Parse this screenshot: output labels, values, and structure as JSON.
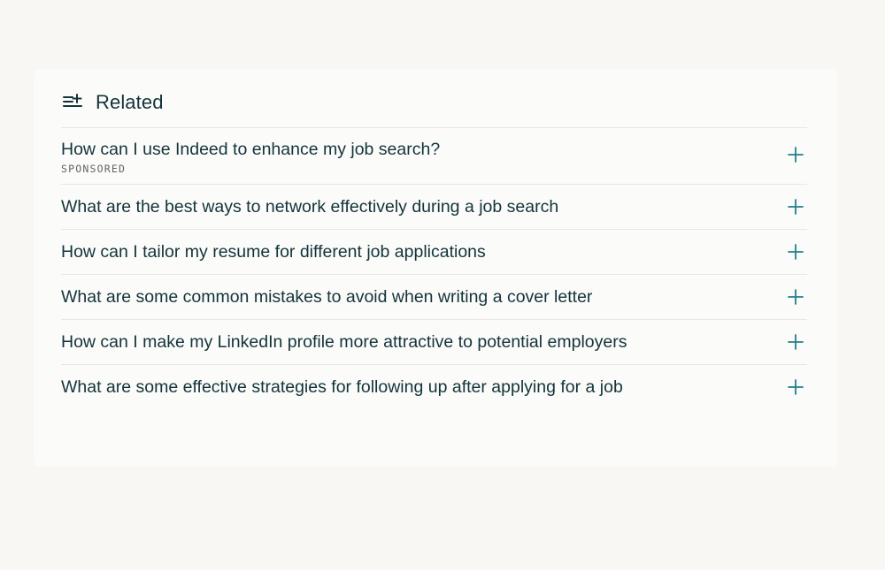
{
  "related": {
    "title": "Related",
    "sponsored_label": "SPONSORED",
    "items": [
      {
        "label": "How can I use Indeed to enhance my job search?",
        "sponsored": true
      },
      {
        "label": "What are the best ways to network effectively during a job search",
        "sponsored": false
      },
      {
        "label": "How can I tailor my resume for different job applications",
        "sponsored": false
      },
      {
        "label": "What are some common mistakes to avoid when writing a cover letter",
        "sponsored": false
      },
      {
        "label": "How can I make my LinkedIn profile more attractive to potential employers",
        "sponsored": false
      },
      {
        "label": "What are some effective strategies for following up after applying for a job",
        "sponsored": false
      }
    ]
  },
  "icons": {
    "header": "related-list-icon",
    "expand": "plus-icon"
  },
  "colors": {
    "text": "#13343b",
    "accent": "#21808d",
    "divider": "#e6e6e2",
    "muted": "#64645e",
    "background": "#f8f7f4"
  }
}
